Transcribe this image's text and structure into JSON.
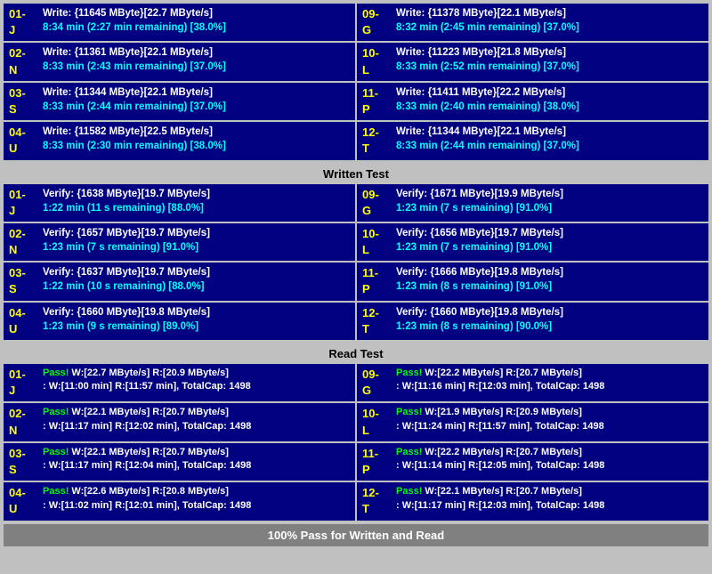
{
  "sections": {
    "write": {
      "label": "Written Test",
      "left_cells": [
        {
          "id": "01-J",
          "row1": "Write: {11645 MByte}[22.7 MByte/s]",
          "row2": "8:34 min (2:27 min remaining)  [38.0%]"
        },
        {
          "id": "02-N",
          "row1": "Write: {11361 MByte}[22.1 MByte/s]",
          "row2": "8:33 min (2:43 min remaining)  [37.0%]"
        },
        {
          "id": "03-S",
          "row1": "Write: {11344 MByte}[22.1 MByte/s]",
          "row2": "8:33 min (2:44 min remaining)  [37.0%]"
        },
        {
          "id": "04-U",
          "row1": "Write: {11582 MByte}[22.5 MByte/s]",
          "row2": "8:33 min (2:30 min remaining)  [38.0%]"
        }
      ],
      "right_cells": [
        {
          "id": "09-G",
          "row1": "Write: {11378 MByte}[22.1 MByte/s]",
          "row2": "8:32 min (2:45 min remaining)  [37.0%]"
        },
        {
          "id": "10-L",
          "row1": "Write: {11223 MByte}[21.8 MByte/s]",
          "row2": "8:33 min (2:52 min remaining)  [37.0%]"
        },
        {
          "id": "11-P",
          "row1": "Write: {11411 MByte}[22.2 MByte/s]",
          "row2": "8:33 min (2:40 min remaining)  [38.0%]"
        },
        {
          "id": "12-T",
          "row1": "Write: {11344 MByte}[22.1 MByte/s]",
          "row2": "8:33 min (2:44 min remaining)  [37.0%]"
        }
      ]
    },
    "verify": {
      "label": "Written Test",
      "left_cells": [
        {
          "id": "01-J",
          "row1": "Verify: {1638 MByte}[19.7 MByte/s]",
          "row2": "1:22 min (11 s remaining)  [88.0%]"
        },
        {
          "id": "02-N",
          "row1": "Verify: {1657 MByte}[19.7 MByte/s]",
          "row2": "1:23 min (7 s remaining)  [91.0%]"
        },
        {
          "id": "03-S",
          "row1": "Verify: {1637 MByte}[19.7 MByte/s]",
          "row2": "1:22 min (10 s remaining)  [88.0%]"
        },
        {
          "id": "04-U",
          "row1": "Verify: {1660 MByte}[19.8 MByte/s]",
          "row2": "1:23 min (9 s remaining)  [89.0%]"
        }
      ],
      "right_cells": [
        {
          "id": "09-G",
          "row1": "Verify: {1671 MByte}[19.9 MByte/s]",
          "row2": "1:23 min (7 s remaining)  [91.0%]"
        },
        {
          "id": "10-L",
          "row1": "Verify: {1656 MByte}[19.7 MByte/s]",
          "row2": "1:23 min (7 s remaining)  [91.0%]"
        },
        {
          "id": "11-P",
          "row1": "Verify: {1666 MByte}[19.8 MByte/s]",
          "row2": "1:23 min (8 s remaining)  [91.0%]"
        },
        {
          "id": "12-T",
          "row1": "Verify: {1660 MByte}[19.8 MByte/s]",
          "row2": "1:23 min (8 s remaining)  [90.0%]"
        }
      ]
    },
    "read": {
      "label": "Read Test",
      "left_cells": [
        {
          "id": "01-J",
          "pass": "Pass!",
          "row1": "W:[22.7 MByte/s] R:[20.9 MByte/s]",
          "row2": "W:[11:00 min] R:[11:57 min], TotalCap: 1498"
        },
        {
          "id": "02-N",
          "pass": "Pass!",
          "row1": "W:[22.1 MByte/s] R:[20.7 MByte/s]",
          "row2": "W:[11:17 min] R:[12:02 min], TotalCap: 1498"
        },
        {
          "id": "03-S",
          "pass": "Pass!",
          "row1": "W:[22.1 MByte/s] R:[20.7 MByte/s]",
          "row2": "W:[11:17 min] R:[12:04 min], TotalCap: 1498"
        },
        {
          "id": "04-U",
          "pass": "Pass!",
          "row1": "W:[22.6 MByte/s] R:[20.8 MByte/s]",
          "row2": "W:[11:02 min] R:[12:01 min], TotalCap: 1498"
        }
      ],
      "right_cells": [
        {
          "id": "09-G",
          "pass": "Pass!",
          "row1": "W:[22.2 MByte/s] R:[20.7 MByte/s]",
          "row2": "W:[11:16 min] R:[12:03 min], TotalCap: 1498"
        },
        {
          "id": "10-L",
          "pass": "Pass!",
          "row1": "W:[21.9 MByte/s] R:[20.9 MByte/s]",
          "row2": "W:[11:24 min] R:[11:57 min], TotalCap: 1498"
        },
        {
          "id": "11-P",
          "pass": "Pass!",
          "row1": "W:[22.2 MByte/s] R:[20.7 MByte/s]",
          "row2": "W:[11:14 min] R:[12:05 min], TotalCap: 1498"
        },
        {
          "id": "12-T",
          "pass": "Pass!",
          "row1": "W:[22.1 MByte/s] R:[20.7 MByte/s]",
          "row2": "W:[11:17 min] R:[12:03 min], TotalCap: 1498"
        }
      ]
    }
  },
  "footer": "100% Pass for Written and Read",
  "section_labels": {
    "written": "Written Test",
    "read": "Read Test"
  }
}
